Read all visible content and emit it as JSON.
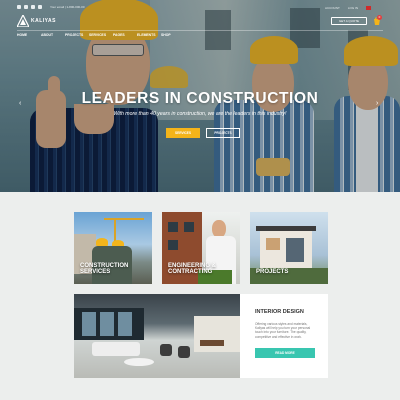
{
  "topbar": {
    "logo_text": "KALIYAS",
    "contact": "Your email | 1-800-000-00",
    "links": [
      "ACCOUNT",
      "LOG IN"
    ],
    "quote_label": "GET A QUOTE",
    "cart_count": "0"
  },
  "nav": {
    "items": [
      "HOME",
      "ABOUT",
      "PROJECTS",
      "SERVICES",
      "PAGES",
      "ELEMENTS",
      "SHOP"
    ]
  },
  "hero": {
    "title": "LEADERS IN CONSTRUCTION",
    "subtitle": "With more than 40 years in construction, we are the leaders in this industry!",
    "primary_button": "SERVICES",
    "secondary_button": "PROJECTS",
    "prev_arrow": "‹",
    "next_arrow": "›"
  },
  "cards": [
    {
      "label": "CONSTRUCTION\nSERVICES"
    },
    {
      "label": "ENGINEERING &\nCONTRACTING"
    },
    {
      "label": "PROJECTS"
    }
  ],
  "interior": {
    "title": "INTERIOR DESIGN",
    "text": "Offering various styles and materials, Kaliyas will help you turn your personal touch into your furniture. The quality, competitive and effective in work.",
    "button": "READ MORE"
  },
  "colors": {
    "accent_yellow": "#f4b41a",
    "accent_teal": "#39c6b0"
  }
}
